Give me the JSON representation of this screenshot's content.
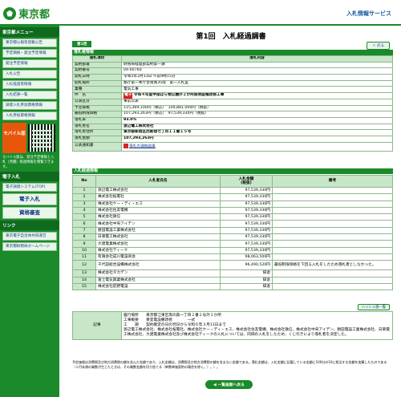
{
  "header": {
    "logo_text": "東京都",
    "service_title": "入札情報サービス"
  },
  "sidebar": {
    "menu_caption": "東京都メニュー",
    "items": [
      "東京都公報等登載公告",
      "予定価格・発注予定情報",
      "発注予定情報",
      "入札公告",
      "入札経過等情報",
      "入札結果一覧",
      "調達入札参加資格情報",
      "入札参加資格情報"
    ],
    "mobile_label": "モバイル版",
    "mobile_note": "モバイル版は、発注予定情報と入札（見積）経過情報を閲覧できます。",
    "system_caption": "電子入札",
    "system_items": [
      "電子調達システム(TOP)",
      "電子入札",
      "資格審査"
    ],
    "link_caption": "リンク",
    "link_items": [
      "東京電子自治体共同運営",
      "東京都財務局ホームページ"
    ]
  },
  "main": {
    "title": "第1回　入札経過調書",
    "tab_label": "第1回",
    "back_button": "＜ 戻る",
    "info_section": "落札者情報",
    "info_head": [
      "落札項目",
      "落札内容"
    ],
    "info_rows": [
      [
        "契約部署",
        "財務局経理部契約第一課"
      ],
      [
        "契約番号",
        "04-00760"
      ],
      [
        "開札日時",
        "令和5年3月13日 午前9時15分"
      ],
      [
        "開札場所",
        "都庁第一本庁舎南側35階　第一入札室"
      ],
      [
        "業種",
        "電気工事"
      ],
      [
        "件　名",
        "令和４年度中部ばら物公園外２か所照明設備改修工事"
      ],
      [
        "公表区分",
        "事前公表"
      ],
      [
        "予定価格",
        "115,369,100円（税込）　104,881,000円（税抜）"
      ],
      [
        "最低制限価格",
        "107,293,263円（税込）　97,539,330円（税抜）"
      ],
      [
        "落札率",
        "93.0%"
      ],
      [
        "落札者名",
        "渡辺電工株式会社"
      ],
      [
        "落札者住所",
        "東京都新宿区西新宿七丁目１１番１５号"
      ],
      [
        "落札金額",
        "107,293,263円"
      ],
      [
        "公表通知書",
        "落札の通知結果"
      ]
    ],
    "title_tag": "電子",
    "bid_section": "入札経過情報",
    "bid_head": [
      "No",
      "入札者氏名",
      "入札金額\n(税抜)",
      "備考"
    ],
    "bids": [
      [
        "1",
        "渡辺電工株式会社",
        "97,539,330円",
        ""
      ],
      [
        "2",
        "株式会社桜電社",
        "97,539,330円",
        ""
      ],
      [
        "3",
        "株式会社ケー・ディ・エス",
        "97,539,330円",
        ""
      ],
      [
        "4",
        "株式会社住友電機",
        "97,539,330円",
        ""
      ],
      [
        "5",
        "株式会社鉄信",
        "97,539,330円",
        ""
      ],
      [
        "6",
        "株式会社中央アイデン",
        "97,539,330円",
        ""
      ],
      [
        "7",
        "勝田電設工業株式会社",
        "97,539,330円",
        ""
      ],
      [
        "8",
        "日東電工株式会社",
        "97,539,330円",
        ""
      ],
      [
        "9",
        "大建電業株式会社",
        "97,539,330円",
        ""
      ],
      [
        "10",
        "株式会社ティーク",
        "97,539,330円",
        ""
      ],
      [
        "11",
        "有限会社成川電設商会",
        "98,063,500円",
        ""
      ],
      [
        "12",
        "千代田総合設備株式会社",
        "96,490,520円",
        "最低制限価格を下回る入札をしたため落札者としなかった。"
      ],
      [
        "13",
        "株式会社タカデン",
        "辞退",
        ""
      ],
      [
        "14",
        "富士電気興業株式会社",
        "辞退",
        ""
      ],
      [
        "15",
        "株式会社前野電設",
        "辞退",
        ""
      ]
    ],
    "gloss_button": "ハッシュ値一覧",
    "notes_label": "記事",
    "notes_text": "履行場所　　東京都江東区南の森一丁目２番２号外２か所\n工事概要　　受変電設備改修　　　　一式\n工　　期　　契約確定の日の翌日から令和６年３月11日まで\n渡辺電工株式会社、株式会社桜電社、株式会社ケー・ディ・エス、株式会社住友電機、株式会社鉄信、株式会社中央アイデン、勝田電設工業株式会社、日東電工株式会社、大建電業株式会社及び株式会社ティークの入札については、同価の入札をしたため、くじ引きにより落札者を決定した。",
    "footer_note": "予定価格は消費税及び地方消費税の額を含んだ金額であり、入札金額は、消費税及び地方消費税の額を含まない金額である。落札金額は、入札金額に記載している金額に100分の10に相当する金額を加算したものである（１円未満の端数が生じたときは、その端数金額を切り捨てる（単数単価契約の場合を除く。）。）。",
    "bottom_button": "◀ 一覧画面へ戻る"
  },
  "colors": {
    "brand_green": "#1a8a2a",
    "header_cell": "#c8e6c8",
    "alert_red": "#e02020"
  }
}
